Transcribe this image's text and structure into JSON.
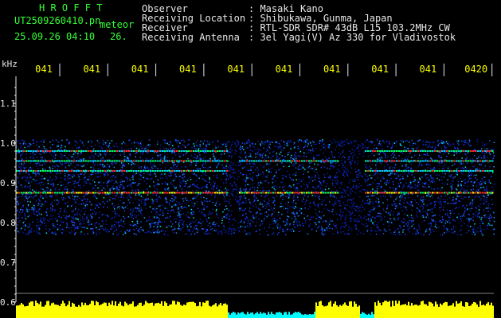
{
  "header": {
    "brand": "H R O F F T",
    "filename": "UT2509260410.pn",
    "suffix": "meteor",
    "datetime": "25.09.26 04:10",
    "value": "26.",
    "fields": [
      {
        "label": "Observer",
        "value": ": Masaki Kano"
      },
      {
        "label": "Receiving Location",
        "value": ": Shibukawa, Gunma, Japan"
      },
      {
        "label": "Receiver",
        "value": ": RTL-SDR SDR# 43dB L15 103.2MHz CW"
      },
      {
        "label": "Receiving Antenna",
        "value": ": 3el Yagi(V) Az 330 for Vladivostok"
      }
    ]
  },
  "chart_data": {
    "type": "heatmap",
    "ylabel": "kHz",
    "yticks": [
      "1.1",
      "1.0",
      "0.9",
      "0.8",
      "0.7",
      "0.6"
    ],
    "ylim": [
      0.6,
      1.2
    ],
    "xticks": [
      "041",
      "041",
      "041",
      "041",
      "041",
      "041",
      "041",
      "041",
      "041",
      "0420"
    ],
    "active_band_khz": [
      0.77,
      1.01
    ],
    "strong_lines_khz": [
      0.875,
      0.955,
      0.98,
      0.93
    ]
  },
  "colors": {
    "background": "#000000",
    "header_green": "#33ff33",
    "axis_white": "#e8e8e8",
    "tick_yellow": "#ffff00",
    "signal_bar": "#ffff00",
    "gap_bar": "#00ffff"
  }
}
